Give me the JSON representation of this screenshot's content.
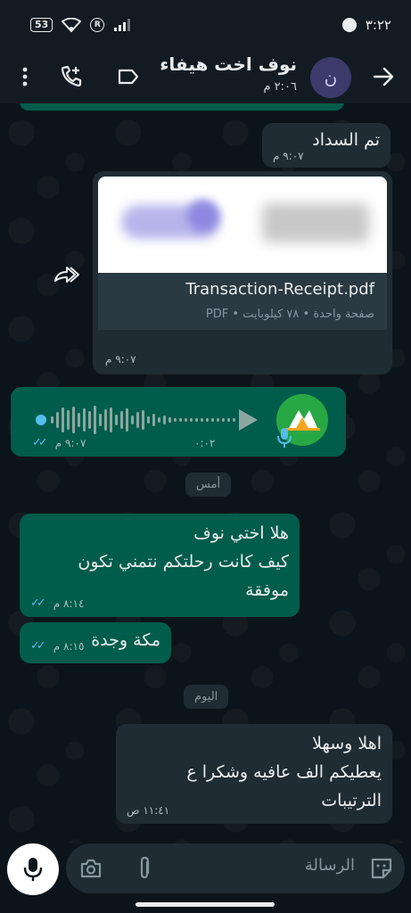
{
  "status_bar": {
    "battery": "53",
    "time": "٣:٢٢"
  },
  "header": {
    "contact_name": "نوف اخت هيفاء",
    "contact_status": "٢:٠٦ م",
    "avatar_letter": "ن"
  },
  "messages": [
    {
      "type": "text",
      "dir": "incoming",
      "text": "تم السداد",
      "time": "٩:٠٧ م"
    },
    {
      "type": "document",
      "dir": "incoming",
      "file_name": "Transaction-Receipt.pdf",
      "file_info": "صفحة واحدة • ٧٨ كيلوبايت • PDF",
      "time": "٩:٠٧ م"
    },
    {
      "type": "voice",
      "dir": "outgoing",
      "duration": "٠:٠٢",
      "time": "٩:٠٧ م"
    },
    {
      "type": "date",
      "label": "أمس"
    },
    {
      "type": "text",
      "dir": "outgoing",
      "line1": "هلا اختي نوف",
      "line2": "كيف كانت رحلتكم نتمني تكون موفقة",
      "time": "٨:١٤ م"
    },
    {
      "type": "text",
      "dir": "outgoing",
      "text": "مكة وجدة",
      "time": "٨:١٥ م"
    },
    {
      "type": "date",
      "label": "اليوم"
    },
    {
      "type": "text",
      "dir": "incoming",
      "line1": "اهلا وسهلا",
      "line2": "يعطيكم الف عافيه وشكرا ع الترتيبات",
      "time": "١١:٤١ ص"
    }
  ],
  "composer": {
    "placeholder": "الرسالة"
  },
  "icons": {
    "menu": "more-vert-icon",
    "add_call": "add-call-icon",
    "label": "label-icon",
    "back": "arrow-back-icon",
    "camera": "camera-icon",
    "attach": "paperclip-icon",
    "sticker": "sticker-icon",
    "mic": "microphone-icon",
    "forward": "forward-icon"
  },
  "colors": {
    "outgoing_bubble": "#005c4b",
    "incoming_bubble": "#202c33",
    "read_ticks": "#53bdeb",
    "background": "#0b141a"
  }
}
